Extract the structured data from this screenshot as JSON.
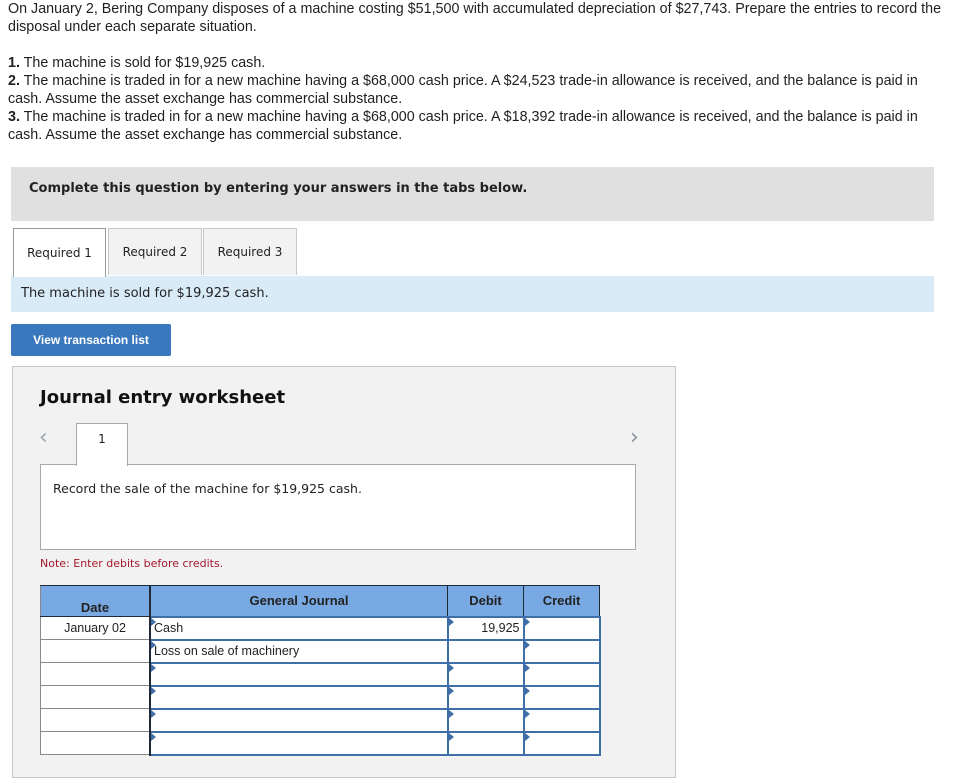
{
  "question": {
    "intro": "On January 2, Bering Company disposes of a machine costing $51,500 with accumulated depreciation of $27,743. Prepare the entries to record the disposal under each separate situation.",
    "items": [
      {
        "num": "1.",
        "text": " The machine is sold for $19,925 cash."
      },
      {
        "num": "2.",
        "text": " The machine is traded in for a new machine having a $68,000 cash price. A $24,523 trade-in allowance is received, and the balance is paid in cash. Assume the asset exchange has commercial substance."
      },
      {
        "num": "3.",
        "text": " The machine is traded in for a new machine having a $68,000 cash price. A $18,392 trade-in allowance is received, and the balance is paid in cash. Assume the asset exchange has commercial substance."
      }
    ]
  },
  "banner": "Complete this question by entering your answers in the tabs below.",
  "tabs": [
    {
      "label": "Required 1",
      "active": true
    },
    {
      "label": "Required 2",
      "active": false
    },
    {
      "label": "Required 3",
      "active": false
    }
  ],
  "info": "The machine is sold for $19,925 cash.",
  "view_transaction_button": "View transaction list",
  "worksheet": {
    "title": "Journal entry worksheet",
    "prev_icon": "‹",
    "next_icon": "›",
    "current_tab": "1",
    "description": "Record the sale of the machine for $19,925 cash.",
    "note": "Note: Enter debits before credits.",
    "columns": {
      "date": "Date",
      "journal": "General Journal",
      "debit": "Debit",
      "credit": "Credit"
    },
    "rows": [
      {
        "date": "January 02",
        "account": "Cash",
        "debit": "19,925",
        "credit": ""
      },
      {
        "date": "",
        "account": "Loss on sale of machinery",
        "debit": "",
        "credit": ""
      },
      {
        "date": "",
        "account": "",
        "debit": "",
        "credit": ""
      },
      {
        "date": "",
        "account": "",
        "debit": "",
        "credit": ""
      },
      {
        "date": "",
        "account": "",
        "debit": "",
        "credit": ""
      },
      {
        "date": "",
        "account": "",
        "debit": "",
        "credit": ""
      }
    ]
  },
  "colors": {
    "primary_button": "#3a78bd",
    "header_blue": "#78a9e3",
    "info_bg": "#daebf8",
    "note_red": "#a0182b"
  }
}
